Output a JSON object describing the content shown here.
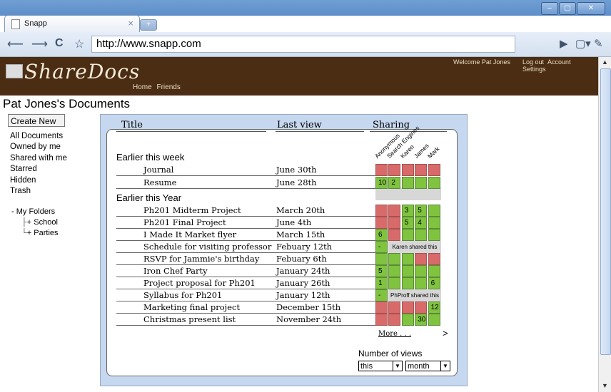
{
  "browser": {
    "tab_title": "Snapp",
    "tab_close": "×",
    "url": "http://www.snapp.com"
  },
  "site": {
    "logo": "ShareDocs",
    "nav": [
      "Home",
      "Friends"
    ],
    "welcome": "Welcome Pat Jones",
    "account_links": [
      "Log out",
      "Account",
      "Settings"
    ]
  },
  "page": {
    "title": "Pat Jones's Documents",
    "create_button": "Create New",
    "side_links": [
      "All Documents",
      "Owned by me",
      "Shared with me",
      "Starred",
      "Hidden",
      "Trash"
    ],
    "folders": {
      "root": "- My Folders",
      "children": [
        "+ School",
        "+ Parties"
      ]
    }
  },
  "table": {
    "headers": {
      "title": "Title",
      "last_view": "Last view",
      "sharing": "Sharing"
    },
    "sharing_columns": [
      "Anonymous",
      "Search Engines",
      "Karen",
      "James",
      "Mark"
    ],
    "sections": [
      "Earlier this week",
      "Earlier this Year"
    ],
    "rows": [
      {
        "name": "Journal",
        "date": "June 30th",
        "cells": [
          [
            "r",
            ""
          ],
          [
            "r",
            ""
          ],
          [
            "r",
            ""
          ],
          [
            "r",
            ""
          ],
          [
            "r",
            ""
          ]
        ]
      },
      {
        "name": "Resume",
        "date": "June 28th",
        "cells": [
          [
            "g",
            "10"
          ],
          [
            "g",
            "2"
          ],
          [
            "g",
            ""
          ],
          [
            "g",
            ""
          ],
          [
            "g",
            ""
          ]
        ]
      },
      {
        "name": "Ph201 Midterm Project",
        "date": "March 20th",
        "cells": [
          [
            "r",
            ""
          ],
          [
            "r",
            ""
          ],
          [
            "g",
            "3"
          ],
          [
            "g",
            "5"
          ],
          [
            "g",
            ""
          ]
        ]
      },
      {
        "name": "Ph201 Final Project",
        "date": "June 4th",
        "cells": [
          [
            "r",
            ""
          ],
          [
            "r",
            ""
          ],
          [
            "g",
            "5"
          ],
          [
            "g",
            "4"
          ],
          [
            "g",
            ""
          ]
        ]
      },
      {
        "name": "I Made It Market flyer",
        "date": "March 15th",
        "cells": [
          [
            "g",
            "6"
          ],
          [
            "r",
            ""
          ],
          [
            "g",
            ""
          ],
          [
            "g",
            ""
          ],
          [
            "g",
            ""
          ]
        ]
      },
      {
        "name": "Schedule for visiting professor",
        "date": "Febuary 12th",
        "cells": [
          [
            "g",
            "-"
          ]
        ],
        "note": "Karen shared this"
      },
      {
        "name": "RSVP for Jammie's birthday",
        "date": "Febuary 6th",
        "cells": [
          [
            "g",
            ""
          ],
          [
            "g",
            ""
          ],
          [
            "g",
            ""
          ],
          [
            "r",
            ""
          ],
          [
            "r",
            ""
          ]
        ]
      },
      {
        "name": "Iron Chef Party",
        "date": "January 24th",
        "cells": [
          [
            "g",
            "5"
          ],
          [
            "g",
            ""
          ],
          [
            "g",
            ""
          ],
          [
            "g",
            ""
          ],
          [
            "g",
            ""
          ]
        ]
      },
      {
        "name": "Project proposal for Ph201",
        "date": "January 26th",
        "cells": [
          [
            "g",
            "1"
          ],
          [
            "g",
            ""
          ],
          [
            "g",
            ""
          ],
          [
            "g",
            ""
          ],
          [
            "g",
            "6"
          ]
        ]
      },
      {
        "name": "Syllabus for Ph201",
        "date": "January 12th",
        "cells": [
          [
            "g",
            "-"
          ]
        ],
        "note": "PhProff shared this"
      },
      {
        "name": "Marketing final project",
        "date": "December 15th",
        "cells": [
          [
            "r",
            ""
          ],
          [
            "r",
            ""
          ],
          [
            "r",
            ""
          ],
          [
            "r",
            ""
          ],
          [
            "g",
            "12"
          ]
        ]
      },
      {
        "name": "Christmas present list",
        "date": "November 24th",
        "cells": [
          [
            "r",
            ""
          ],
          [
            "r",
            ""
          ],
          [
            "g",
            ""
          ],
          [
            "g",
            "30"
          ],
          [
            "g",
            ""
          ]
        ]
      }
    ],
    "more": "More . . .",
    "more_arrow": ">",
    "views_label": "Number of views",
    "views_select_1": "this",
    "views_select_2": "month"
  },
  "colors": {
    "header_bg": "#4a2d13",
    "cell_green": "#7fc33f",
    "cell_red": "#d86a6a"
  }
}
